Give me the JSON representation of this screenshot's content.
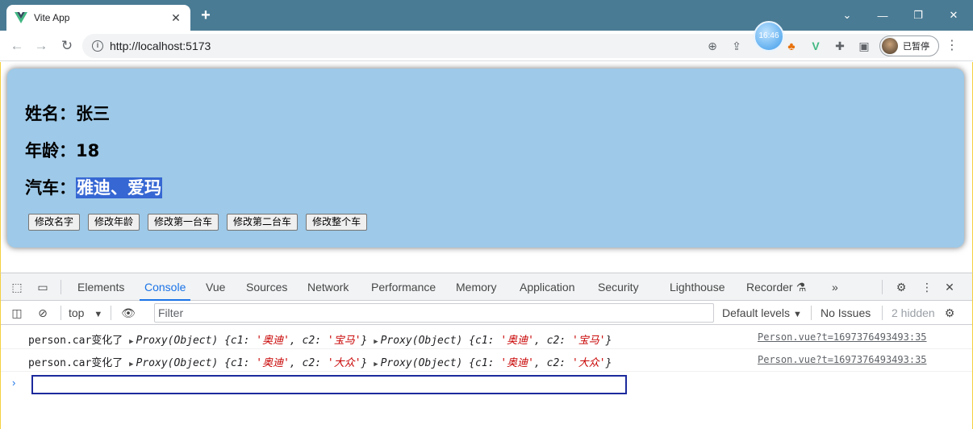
{
  "browser": {
    "tab_title": "Vite App",
    "tab_close": "✕",
    "new_tab": "+",
    "url": "http://localhost:5173",
    "clock_time": "16:46",
    "profile_label": "已暂停"
  },
  "icons": {
    "back": "arrow-left-icon",
    "forward": "arrow-right-icon",
    "reload": "reload-icon",
    "zoom": "zoom-icon",
    "share": "share-icon",
    "star": "star-icon",
    "extension": "puzzle-icon"
  },
  "page": {
    "name_label": "姓名：",
    "name_value": "张三",
    "age_label": "年龄：",
    "age_value": "18",
    "car_label": "汽车：",
    "car_value": "雅迪、爱玛",
    "buttons": {
      "change_name": "修改名字",
      "change_age": "修改年龄",
      "change_car1": "修改第一台车",
      "change_car2": "修改第二台车",
      "change_all": "修改整个车"
    },
    "colors": {
      "card_bg": "#9ec9e8",
      "selection": "#3667d3"
    }
  },
  "devtools": {
    "tabs": [
      "Elements",
      "Console",
      "Vue",
      "Sources",
      "Network",
      "Performance",
      "Memory",
      "Application",
      "Security",
      "Lighthouse",
      "Recorder"
    ],
    "more_tabs": "»",
    "context": "top",
    "filter_placeholder": "Filter",
    "default_levels": "Default levels",
    "issues": "No Issues",
    "hidden": "2 hidden",
    "logs": [
      {
        "prefix": "person.car变化了",
        "obj1": "Proxy(Object) {c1: ",
        "obj1_c1": "'奥迪'",
        "obj1_mid": ", c2: ",
        "obj1_c2": "'宝马'",
        "obj1_end": "}",
        "obj2": "Proxy(Object) {c1: ",
        "obj2_c1": "'奥迪'",
        "obj2_mid": ", c2: ",
        "obj2_c2": "'宝马'",
        "obj2_end": "}",
        "source": "Person.vue?t=1697376493493:35"
      },
      {
        "prefix": "person.car变化了",
        "obj1": "Proxy(Object) {c1: ",
        "obj1_c1": "'奥迪'",
        "obj1_mid": ", c2: ",
        "obj1_c2": "'大众'",
        "obj1_end": "}",
        "obj2": "Proxy(Object) {c1: ",
        "obj2_c1": "'奥迪'",
        "obj2_mid": ", c2: ",
        "obj2_c2": "'大众'",
        "obj2_end": "}",
        "source": "Person.vue?t=1697376493493:35"
      }
    ],
    "prompt": "›"
  }
}
